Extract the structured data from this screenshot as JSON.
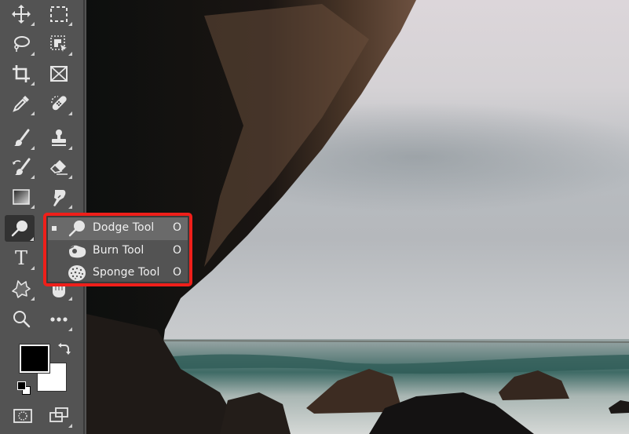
{
  "app": "Photoshop",
  "toolbar": {
    "tools": [
      {
        "name": "move-tool",
        "icon": "move-icon",
        "has_submenu": true
      },
      {
        "name": "rectangular-marquee-tool",
        "icon": "marquee-icon",
        "has_submenu": true
      },
      {
        "name": "lasso-tool",
        "icon": "lasso-icon",
        "has_submenu": true
      },
      {
        "name": "object-selection-tool",
        "icon": "object-selection-icon",
        "has_submenu": true
      },
      {
        "name": "crop-tool",
        "icon": "crop-icon",
        "has_submenu": true
      },
      {
        "name": "frame-tool",
        "icon": "frame-icon",
        "has_submenu": false
      },
      {
        "name": "eyedropper-tool",
        "icon": "eyedropper-icon",
        "has_submenu": true
      },
      {
        "name": "spot-healing-brush-tool",
        "icon": "bandage-icon",
        "has_submenu": true
      },
      {
        "name": "brush-tool",
        "icon": "brush-icon",
        "has_submenu": true
      },
      {
        "name": "clone-stamp-tool",
        "icon": "stamp-icon",
        "has_submenu": true
      },
      {
        "name": "history-brush-tool",
        "icon": "history-brush-icon",
        "has_submenu": true
      },
      {
        "name": "eraser-tool",
        "icon": "eraser-icon",
        "has_submenu": true
      },
      {
        "name": "gradient-tool",
        "icon": "gradient-icon",
        "has_submenu": true
      },
      {
        "name": "smudge-tool",
        "icon": "smudge-icon",
        "has_submenu": true
      },
      {
        "name": "dodge-tool",
        "icon": "dodge-icon",
        "has_submenu": true,
        "active": true
      },
      {
        "name": "type-tool",
        "icon": "type-icon",
        "has_submenu": true
      },
      {
        "name": "custom-shape-tool",
        "icon": "shape-icon",
        "has_submenu": true
      },
      {
        "name": "hand-tool",
        "icon": "hand-icon",
        "has_submenu": true
      },
      {
        "name": "zoom-tool",
        "icon": "zoom-icon",
        "has_submenu": false
      },
      {
        "name": "edit-toolbar",
        "icon": "more-icon",
        "has_submenu": true
      }
    ],
    "type_glyph": "T",
    "foreground_color": "#000000",
    "background_color": "#ffffff",
    "quick_mask": "quick-mask-icon",
    "screen_mode": "screen-mode-icon"
  },
  "flyout": {
    "highlight_color": "#ef1f1a",
    "items": [
      {
        "label": "Dodge Tool",
        "shortcut": "O",
        "icon": "dodge-icon",
        "selected": true
      },
      {
        "label": "Burn Tool",
        "shortcut": "O",
        "icon": "burn-icon",
        "selected": false
      },
      {
        "label": "Sponge Tool",
        "shortcut": "O",
        "icon": "sponge-icon",
        "selected": false
      }
    ]
  },
  "canvas": {
    "image": "sea-cave-coastline-photo"
  }
}
